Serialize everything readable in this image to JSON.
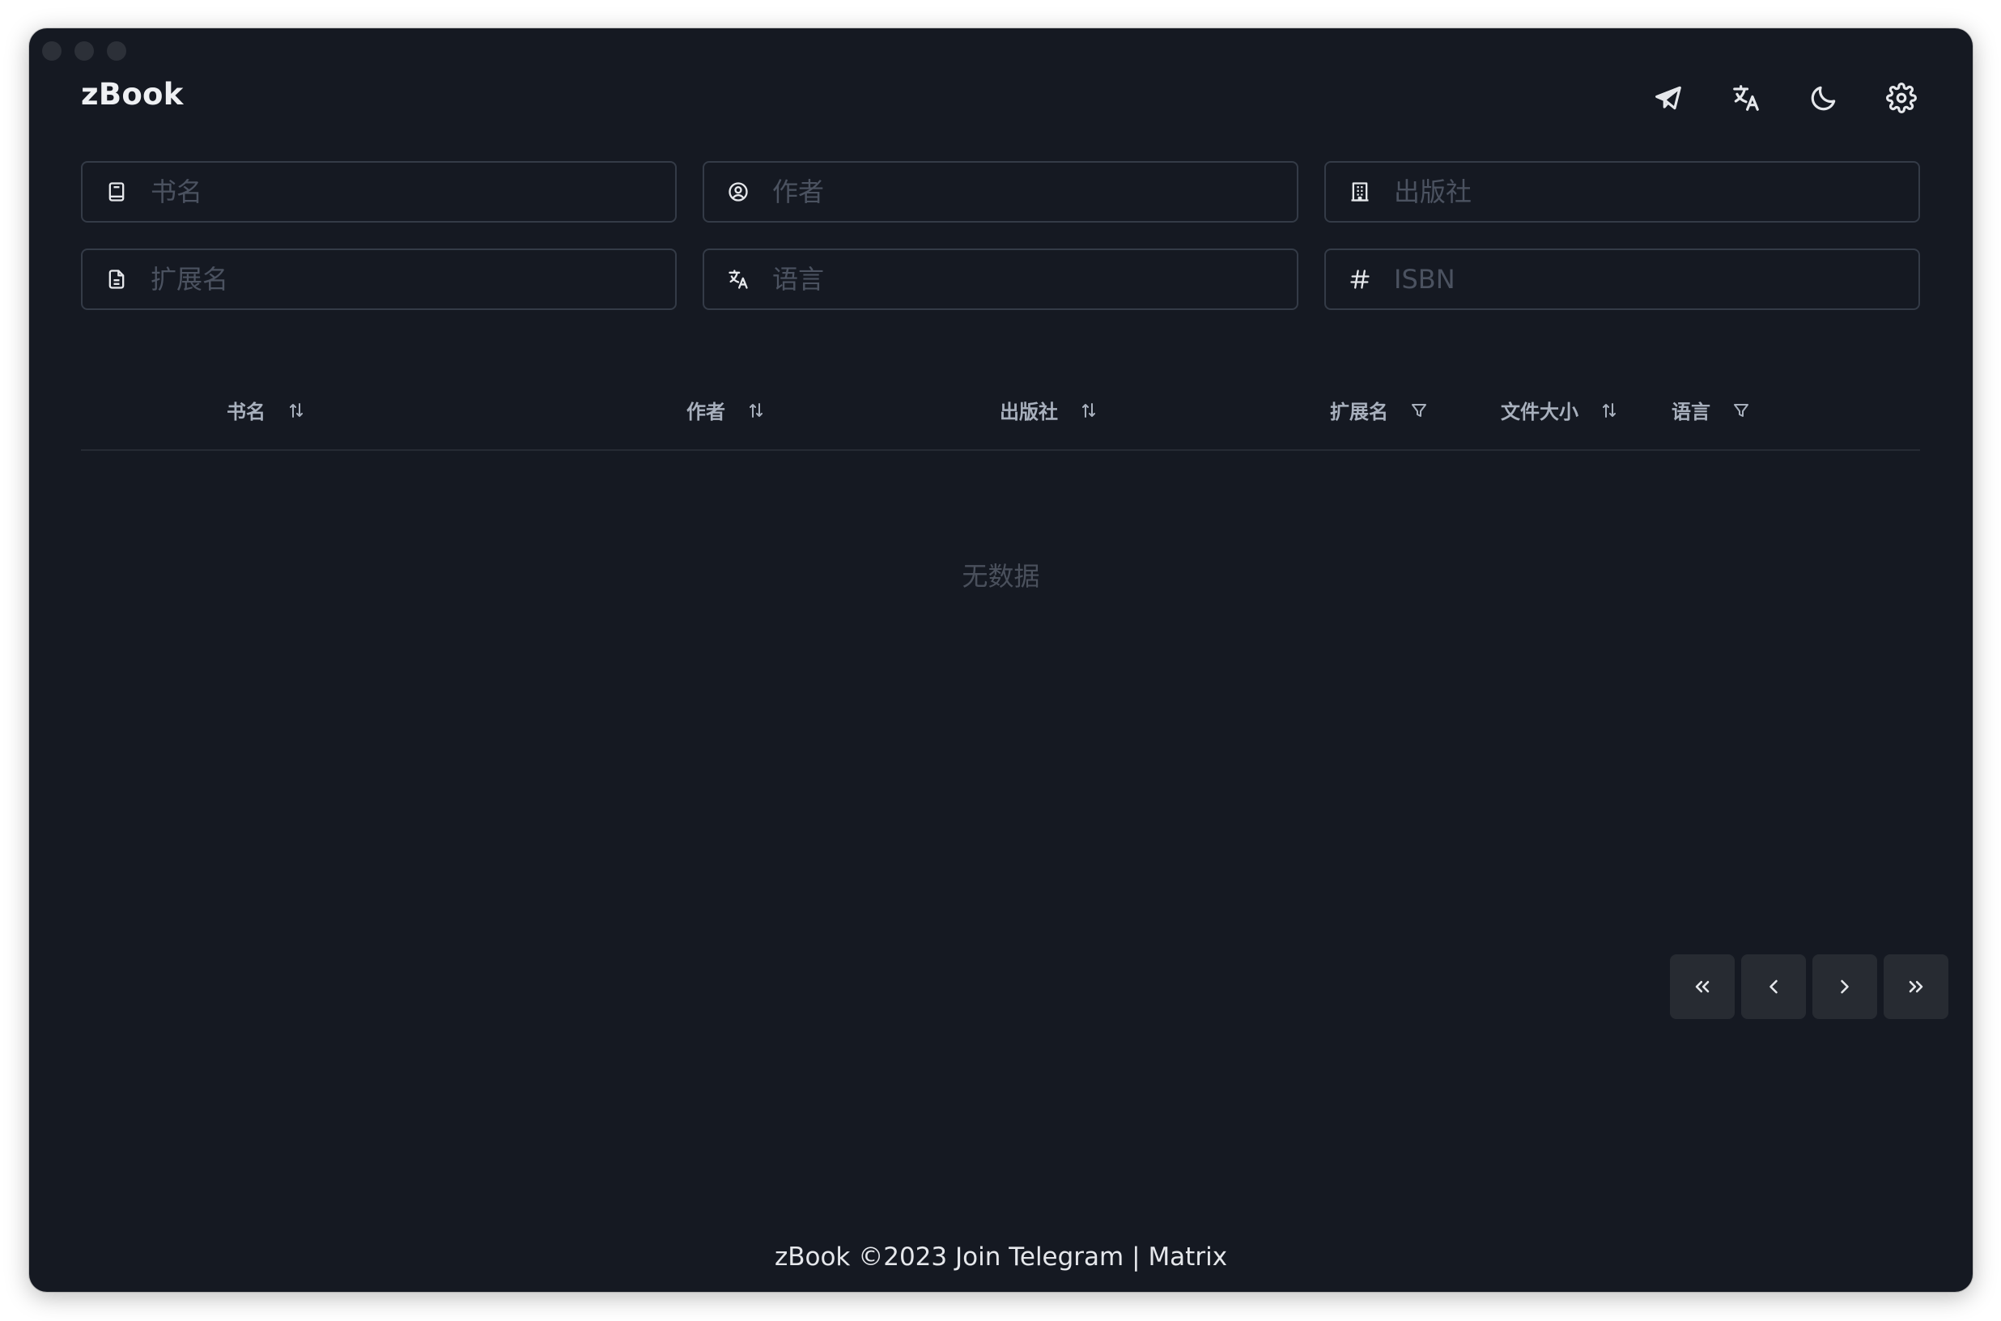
{
  "app": {
    "title": "zBook"
  },
  "top_actions": [
    {
      "icon": "telegram-icon"
    },
    {
      "icon": "translate-icon"
    },
    {
      "icon": "moon-icon"
    },
    {
      "icon": "settings-icon"
    }
  ],
  "filters": {
    "title_placeholder": "书名",
    "author_placeholder": "作者",
    "publisher_placeholder": "出版社",
    "extension_placeholder": "扩展名",
    "language_placeholder": "语言",
    "isbn_placeholder": "ISBN"
  },
  "table": {
    "columns": [
      {
        "label": "书名",
        "control": "sort"
      },
      {
        "label": "作者",
        "control": "sort"
      },
      {
        "label": "出版社",
        "control": "sort"
      },
      {
        "label": "扩展名",
        "control": "filter"
      },
      {
        "label": "文件大小",
        "control": "sort"
      },
      {
        "label": "语言",
        "control": "filter"
      }
    ],
    "empty_text": "无数据"
  },
  "pagination": {
    "first": "«",
    "prev": "‹",
    "next": "›",
    "last": "»"
  },
  "footer": {
    "copyright": "zBook ©2023",
    "telegram_link": "Join Telegram",
    "separator": "|",
    "matrix_link": "Matrix"
  }
}
